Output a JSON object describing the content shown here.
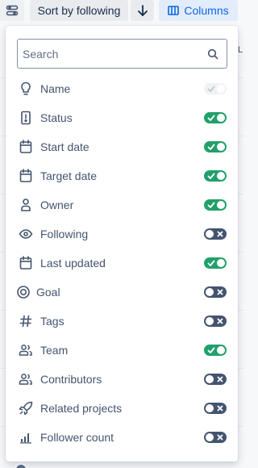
{
  "toolbar": {
    "filter_icon": "filter-settings-icon",
    "sort_label": "Sort by following",
    "sort_direction_icon": "arrow-down-icon",
    "columns_label": "Columns",
    "columns_icon": "columns-icon"
  },
  "background": {
    "column_letter": "L"
  },
  "popup": {
    "search_placeholder": "Search",
    "search_value": "",
    "columns": [
      {
        "label": "Name",
        "icon": "lightbulb-icon",
        "state": "disabled-on"
      },
      {
        "label": "Status",
        "icon": "status-icon",
        "state": "on"
      },
      {
        "label": "Start date",
        "icon": "calendar-icon",
        "state": "on"
      },
      {
        "label": "Target date",
        "icon": "calendar-icon",
        "state": "on"
      },
      {
        "label": "Owner",
        "icon": "person-icon",
        "state": "on"
      },
      {
        "label": "Following",
        "icon": "eye-icon",
        "state": "off"
      },
      {
        "label": "Last updated",
        "icon": "calendar-icon",
        "state": "on"
      },
      {
        "label": "Goal",
        "icon": "target-icon",
        "state": "off"
      },
      {
        "label": "Tags",
        "icon": "hashtag-icon",
        "state": "off"
      },
      {
        "label": "Team",
        "icon": "people-icon",
        "state": "on"
      },
      {
        "label": "Contributors",
        "icon": "people-icon",
        "state": "off"
      },
      {
        "label": "Related projects",
        "icon": "rocket-icon",
        "state": "off"
      },
      {
        "label": "Follower count",
        "icon": "bar-chart-icon",
        "state": "off"
      }
    ]
  },
  "colors": {
    "toggle_on": "#22a06b",
    "toggle_off": "#44546f",
    "accent": "#0c66e4"
  }
}
